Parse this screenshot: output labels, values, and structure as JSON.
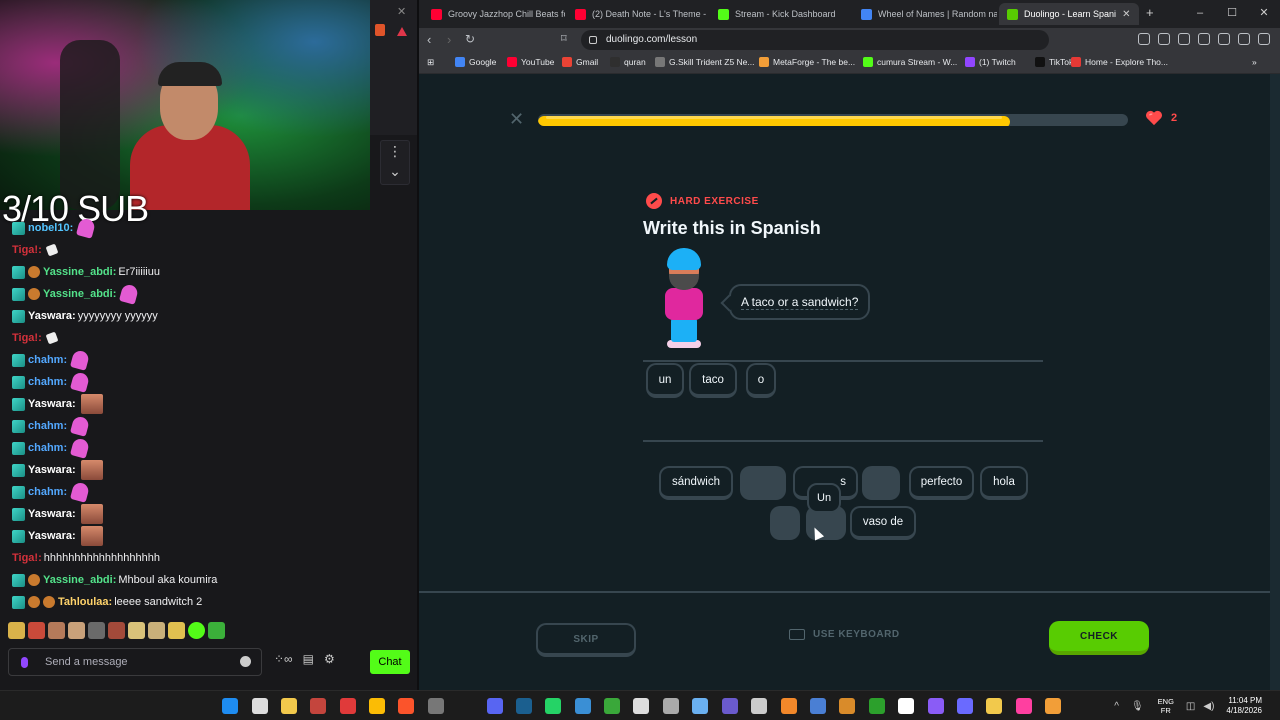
{
  "stream": {
    "sub_counter": "3/10 SUB"
  },
  "chat": {
    "messages": [
      {
        "user": "nobel10:",
        "color": "#53c4ff",
        "text": "",
        "emote": "hand",
        "badges": 1
      },
      {
        "user": "Tiga!:",
        "color": "#d4313b",
        "text": "",
        "emote": "cursor",
        "badges": 0
      },
      {
        "user": "Yassine_abdi:",
        "color": "#53e28a",
        "text": "Er7iiiiiuu",
        "emote": "",
        "badges": 2
      },
      {
        "user": "Yassine_abdi:",
        "color": "#53e28a",
        "text": "",
        "emote": "hand",
        "badges": 2
      },
      {
        "user": "Yaswara:",
        "color": "#ffffff",
        "text": "yyyyyyyy yyyyyy",
        "emote": "",
        "badges": 1
      },
      {
        "user": "Tiga!:",
        "color": "#d4313b",
        "text": "",
        "emote": "cursor",
        "badges": 0
      },
      {
        "user": "chahm:",
        "color": "#53a8ff",
        "text": "",
        "emote": "hand",
        "badges": 1
      },
      {
        "user": "chahm:",
        "color": "#53a8ff",
        "text": "",
        "emote": "hand",
        "badges": 1
      },
      {
        "user": "Yaswara:",
        "color": "#ffffff",
        "text": "",
        "emote": "face",
        "badges": 1
      },
      {
        "user": "chahm:",
        "color": "#53a8ff",
        "text": "",
        "emote": "hand",
        "badges": 1
      },
      {
        "user": "chahm:",
        "color": "#53a8ff",
        "text": "",
        "emote": "hand",
        "badges": 1
      },
      {
        "user": "Yaswara:",
        "color": "#ffffff",
        "text": "",
        "emote": "face",
        "badges": 1
      },
      {
        "user": "chahm:",
        "color": "#53a8ff",
        "text": "",
        "emote": "hand",
        "badges": 1
      },
      {
        "user": "Yaswara:",
        "color": "#ffffff",
        "text": "",
        "emote": "face",
        "badges": 1
      },
      {
        "user": "Yaswara:",
        "color": "#ffffff",
        "text": "",
        "emote": "face",
        "badges": 1
      },
      {
        "user": "Tiga!:",
        "color": "#d4313b",
        "text": "hhhhhhhhhhhhhhhhhhh",
        "emote": "",
        "badges": 0
      },
      {
        "user": "Yassine_abdi:",
        "color": "#53e28a",
        "text": "Mhboul aka koumira",
        "emote": "",
        "badges": 2
      },
      {
        "user": "Tahloulaa:",
        "color": "#ffd36b",
        "text": "leeee sandwitch 2",
        "emote": "",
        "badges": 3
      }
    ],
    "input_placeholder": "Send a message",
    "chat_button": "Chat"
  },
  "browser": {
    "tabs": [
      {
        "title": "Groovy Jazzhop Chill Beats for",
        "fav_color": "#ff0033",
        "active": false
      },
      {
        "title": "(2) Death Note - L's Theme - Vi",
        "fav_color": "#ff0033",
        "active": false
      },
      {
        "title": "Stream - Kick Dashboard",
        "fav_color": "#53fc18",
        "active": false
      },
      {
        "title": "Wheel of Names | Random nam",
        "fav_color": "#4285f4",
        "active": false
      },
      {
        "title": "Duolingo - Learn Spani",
        "fav_color": "#58cc02",
        "active": true
      }
    ],
    "url": "duolingo.com/lesson",
    "bookmarks": [
      {
        "label": "Google",
        "fav_color": "#4285f4"
      },
      {
        "label": "YouTube",
        "fav_color": "#ff0033"
      },
      {
        "label": "Gmail",
        "fav_color": "#ea4335"
      },
      {
        "label": "quran",
        "fav_color": "#2f2f2f"
      },
      {
        "label": "G.Skill Trident Z5 Ne...",
        "fav_color": "#777777"
      },
      {
        "label": "MetaForge - The be...",
        "fav_color": "#f29e38"
      },
      {
        "label": "cumura Stream - W...",
        "fav_color": "#53fc18"
      },
      {
        "label": "(1) Twitch",
        "fav_color": "#9146ff"
      },
      {
        "label": "TikTok",
        "fav_color": "#111111"
      },
      {
        "label": "Home - Explore Tho...",
        "fav_color": "#e53935"
      }
    ]
  },
  "lesson": {
    "progress_fraction": 0.8,
    "hearts": "2",
    "exercise_label": "HARD EXERCISE",
    "title": "Write this in Spanish",
    "prompt": "A taco or a sandwich?",
    "answer_words": [
      "un",
      "taco",
      "o"
    ],
    "bank_row1": [
      {
        "word": "sándwich",
        "empty": false
      },
      {
        "word": "",
        "empty": true
      },
      {
        "word": "s",
        "empty": false
      },
      {
        "word": "",
        "empty": true
      },
      {
        "word": "perfecto",
        "empty": false
      },
      {
        "word": "hola",
        "empty": false
      }
    ],
    "bank_row2": [
      {
        "word": "",
        "empty": true
      },
      {
        "word": "",
        "empty": true
      },
      {
        "word": "vaso de",
        "empty": false
      }
    ],
    "dragged_word": "Un",
    "skip": "SKIP",
    "use_keyboard": "USE KEYBOARD",
    "check": "CHECK"
  },
  "taskbar": {
    "lang_top": "ENG",
    "lang_bottom": "FR",
    "time": "11:04 PM",
    "date": "4/18/2026"
  },
  "colors": {
    "duo_bg": "#131f24",
    "duo_green": "#58cc02",
    "duo_yellow": "#ffc800",
    "duo_red": "#ff4b4b",
    "kick_green": "#53fc18"
  }
}
